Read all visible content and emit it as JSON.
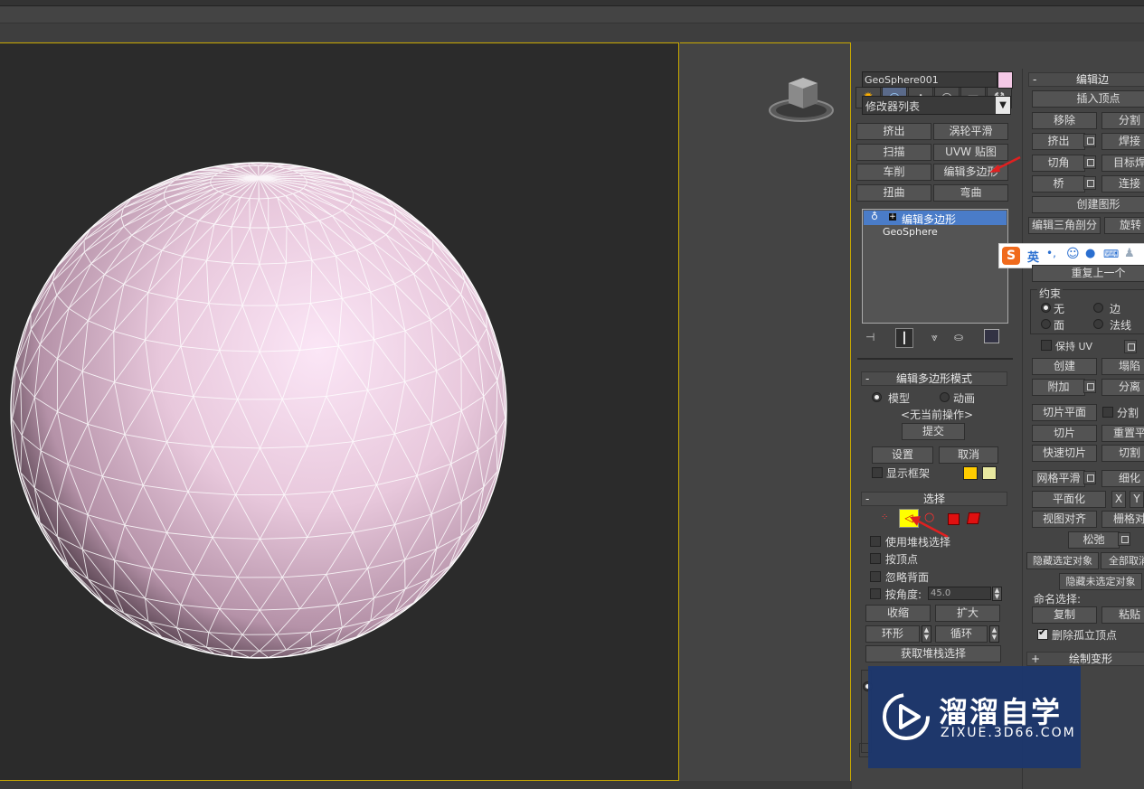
{
  "object": {
    "name": "GeoSphere001",
    "color": "#f4c8e6"
  },
  "modifier_list": {
    "label": "修改器列表"
  },
  "modifier_buttons": [
    "挤出",
    "涡轮平滑",
    "扫描",
    "UVW 贴图",
    "车削",
    "编辑多边形",
    "扭曲",
    "弯曲"
  ],
  "stack": {
    "active": "编辑多边形",
    "base": "GeoSphere"
  },
  "edit_poly_mode": {
    "header": "编辑多边形模式",
    "model": "模型",
    "animate": "动画",
    "no_op": "<无当前操作>",
    "commit": "提交",
    "settings": "设置",
    "cancel": "取消",
    "show_cage": "显示框架",
    "cage_colors": [
      "#ffcc00",
      "#e8e8a0"
    ]
  },
  "selection": {
    "header": "选择",
    "use_stack": "使用堆栈选择",
    "by_vertex": "按顶点",
    "ignore_backface": "忽略背面",
    "by_angle": "按角度:",
    "angle_value": "45.0",
    "shrink": "收缩",
    "grow": "扩大",
    "ring": "环形",
    "loop": "循环",
    "get_stack": "获取堆栈选择"
  },
  "edit_edges": {
    "header": "编辑边",
    "insert_vertex": "插入顶点",
    "remove": "移除",
    "split": "分割",
    "extrude": "挤出",
    "weld": "焊接",
    "chamfer": "切角",
    "target_weld": "目标焊",
    "bridge": "桥",
    "connect": "连接",
    "create_shape": "创建图形",
    "edit_tri": "编辑三角剖分",
    "turn": "旋转"
  },
  "ime": {
    "lang": "英",
    "punct": "•,"
  },
  "edit_geometry": {
    "repeat_last": "重复上一个",
    "constraints": "约束",
    "none": "无",
    "edge": "边",
    "face": "面",
    "normal": "法线",
    "preserve_uv": "保持 UV",
    "create": "创建",
    "collapse": "塌陷",
    "attach": "附加",
    "detach": "分离",
    "slice_plane": "切片平面",
    "split": "分割",
    "slice": "切片",
    "reset_plane": "重置平",
    "quick_slice": "快速切片",
    "cut": "切割",
    "meshsmooth": "网格平滑",
    "tessellate": "细化",
    "make_planar": "平面化",
    "x": "X",
    "y": "Y",
    "view_align": "视图对齐",
    "grid_align": "栅格对",
    "relax": "松弛",
    "hide_selected": "隐藏选定对象",
    "unhide_all": "全部取消",
    "hide_unselected": "隐藏未选定对象",
    "named_sel": "命名选择:",
    "copy": "复制",
    "paste": "粘贴",
    "delete_isolated": "删除孤立顶点",
    "paint_deform": "绘制变形"
  },
  "watermark": {
    "name": "溜溜自学",
    "url": "ZIXUE.3D66.COM"
  }
}
